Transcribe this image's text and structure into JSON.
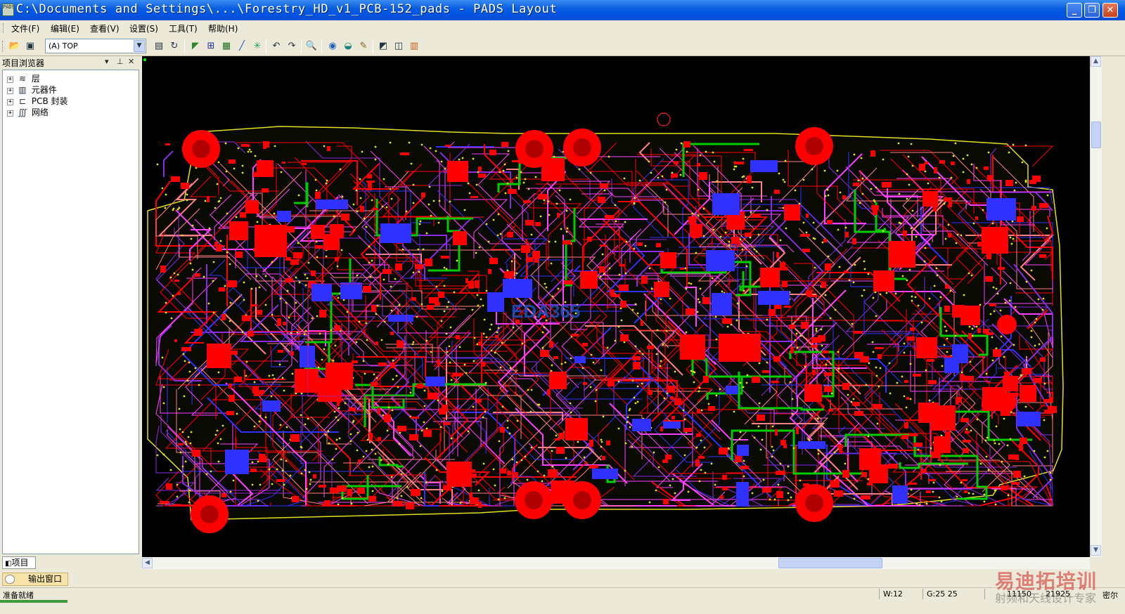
{
  "window": {
    "title": "C:\\Documents and Settings\\...\\Forestry_HD_v1_PCB-152_pads - PADS Layout",
    "app_icon_text": "PADS",
    "controls": {
      "minimize": "_",
      "maximize": "❐",
      "close": "✕"
    }
  },
  "menu": [
    "文件(F)",
    "编辑(E)",
    "查看(V)",
    "设置(S)",
    "工具(T)",
    "帮助(H)"
  ],
  "toolbar": {
    "layer_value": "(A) TOP",
    "layer_dropdown_icon": "chevron-down-icon",
    "icons": [
      "open-icon",
      "save-icon",
      "properties-icon",
      "refresh-icon",
      "route-icon",
      "grid-icon",
      "pour-icon",
      "line-icon",
      "snap-icon",
      "undo-icon",
      "redo-icon",
      "zoom-icon",
      "view-icon",
      "layers-icon",
      "highlight-icon",
      "report-icon",
      "window-icon",
      "pads-icon"
    ]
  },
  "project_panel": {
    "title": "项目浏览器",
    "tree": [
      {
        "label": "层",
        "icon": "layers-icon"
      },
      {
        "label": "元器件",
        "icon": "component-icon"
      },
      {
        "label": "PCB 封装",
        "icon": "footprint-icon"
      },
      {
        "label": "网络",
        "icon": "net-icon"
      }
    ],
    "tab_label": "项目"
  },
  "canvas": {
    "background": "#000000",
    "colors": {
      "pad": "#ff0000",
      "trace_top": "#ff0000",
      "trace_inner": "#ff40ff",
      "trace_green": "#00cc00",
      "trace_blue": "#3030ff",
      "outline": "#e0e020",
      "via": "#e0e020"
    },
    "watermark": "EDA365"
  },
  "output_window": {
    "label": "输出窗口"
  },
  "status": {
    "ready": "准备就绪",
    "width": "W:12",
    "grid": "G:25 25",
    "x": "11150",
    "y": "21925",
    "units": "密尔"
  },
  "branding": {
    "watermark_cn": "易迪拓培训",
    "watermark_sub": "射频和天线设计专家"
  }
}
